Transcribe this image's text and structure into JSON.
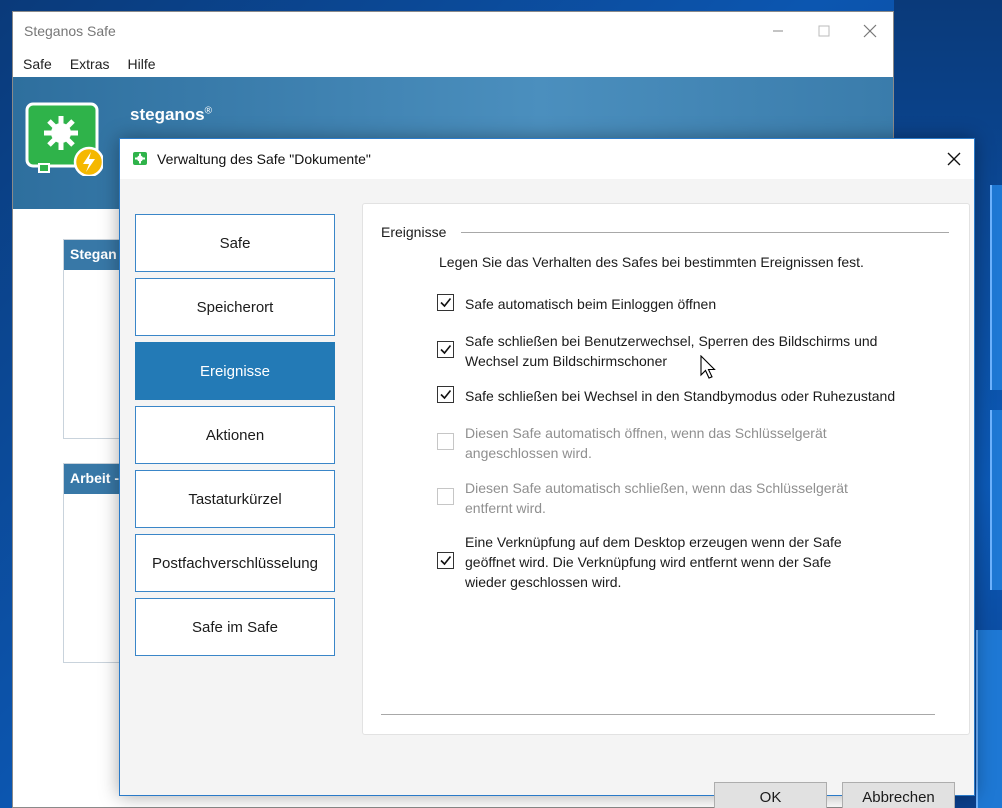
{
  "main_window": {
    "title": "Steganos Safe",
    "menu": [
      "Safe",
      "Extras",
      "Hilfe"
    ],
    "brand": "steganos",
    "brand_mark": "®",
    "panels": [
      {
        "title": "Stegan"
      },
      {
        "title": "Arbeit -"
      }
    ]
  },
  "dialog": {
    "title": "Verwaltung des Safe \"Dokumente\"",
    "nav": [
      {
        "label": "Safe",
        "active": false
      },
      {
        "label": "Speicherort",
        "active": false
      },
      {
        "label": "Ereignisse",
        "active": true
      },
      {
        "label": "Aktionen",
        "active": false
      },
      {
        "label": "Tastaturkürzel",
        "active": false
      },
      {
        "label": "Postfachverschlüsselung",
        "active": false
      },
      {
        "label": "Safe im Safe",
        "active": false
      }
    ],
    "group_label": "Ereignisse",
    "intro": "Legen Sie das Verhalten des Safes bei bestimmten Ereignissen fest.",
    "options": [
      {
        "line1": "Safe automatisch beim Einloggen öffnen",
        "line2": "",
        "line3": "",
        "checked": true,
        "enabled": true
      },
      {
        "line1": "Safe schließen bei Benutzerwechsel, Sperren des Bildschirms und",
        "line2": "Wechsel zum Bildschirmschoner",
        "line3": "",
        "checked": true,
        "enabled": true
      },
      {
        "line1": "Safe schließen bei Wechsel in den Standbymodus oder Ruhezustand",
        "line2": "",
        "line3": "",
        "checked": true,
        "enabled": true
      },
      {
        "line1": "Diesen Safe automatisch öffnen, wenn das Schlüsselgerät",
        "line2": "angeschlossen wird.",
        "line3": "",
        "checked": false,
        "enabled": false
      },
      {
        "line1": "Diesen Safe automatisch schließen, wenn das Schlüsselgerät",
        "line2": "entfernt wird.",
        "line3": "",
        "checked": false,
        "enabled": false
      },
      {
        "line1": "Eine Verknüpfung auf dem Desktop erzeugen wenn der Safe",
        "line2": "geöffnet wird. Die Verknüpfung wird entfernt wenn der Safe",
        "line3": "wieder geschlossen wird.",
        "checked": true,
        "enabled": true
      }
    ],
    "ok_label": "OK",
    "cancel_label": "Abbrechen"
  },
  "colors": {
    "accent": "#237ab6",
    "header": "#3878a7",
    "logo_green": "#2fb34a",
    "bolt": "#f5b800"
  },
  "icons": [
    "safe-logo-icon",
    "bolt-icon",
    "close-icon",
    "minimize-icon",
    "maximize-icon",
    "checkmark-icon",
    "mouse-cursor-icon"
  ]
}
